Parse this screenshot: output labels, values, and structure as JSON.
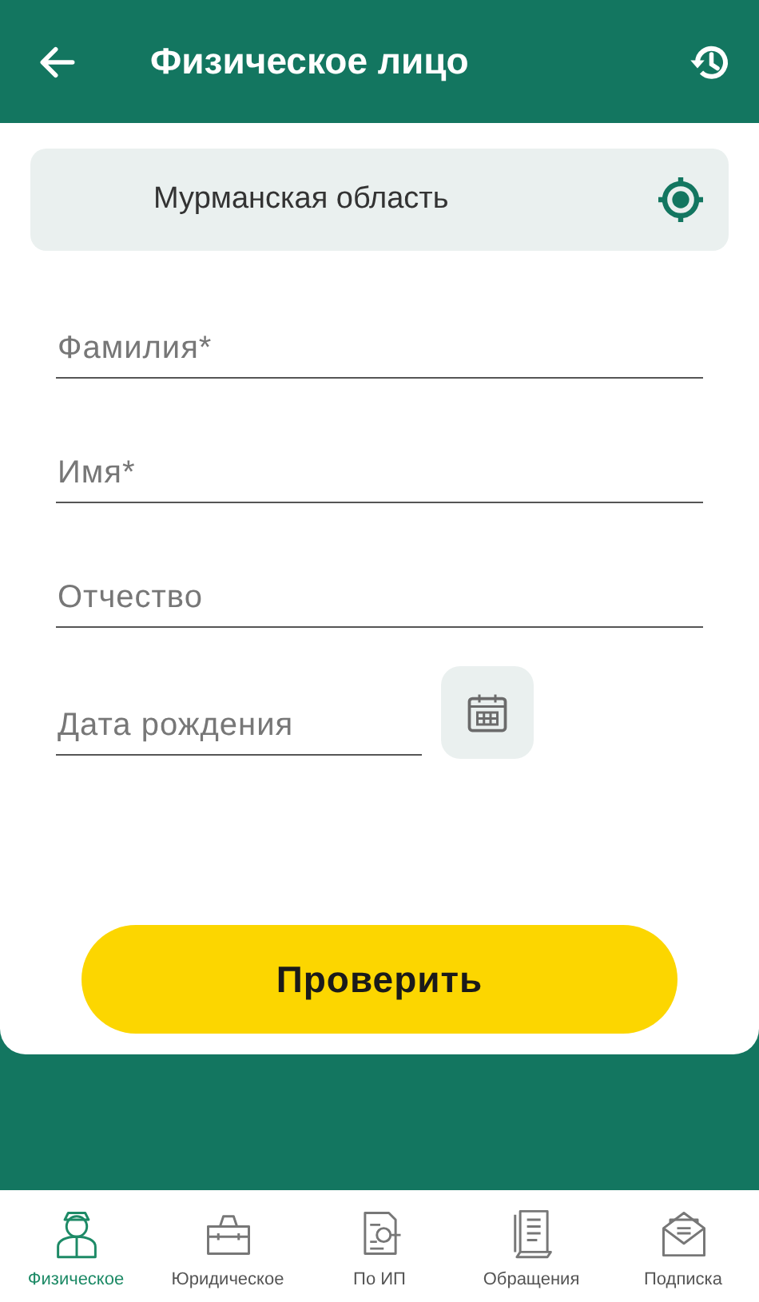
{
  "header": {
    "title": "Физическое лицо"
  },
  "region": {
    "value": "Мурманская область"
  },
  "fields": [
    {
      "placeholder": "Фамилия*",
      "kind": "text"
    },
    {
      "placeholder": "Имя*",
      "kind": "text"
    },
    {
      "placeholder": "Отчество",
      "kind": "text"
    },
    {
      "placeholder": "Дата рождения",
      "kind": "date"
    }
  ],
  "submit": {
    "label": "Проверить"
  },
  "nav": [
    {
      "label": "Физическое",
      "selected": true
    },
    {
      "label": "Юридическое",
      "selected": false
    },
    {
      "label": "По ИП",
      "selected": false
    },
    {
      "label": "Обращения",
      "selected": false
    },
    {
      "label": "Подписка",
      "selected": false
    }
  ]
}
